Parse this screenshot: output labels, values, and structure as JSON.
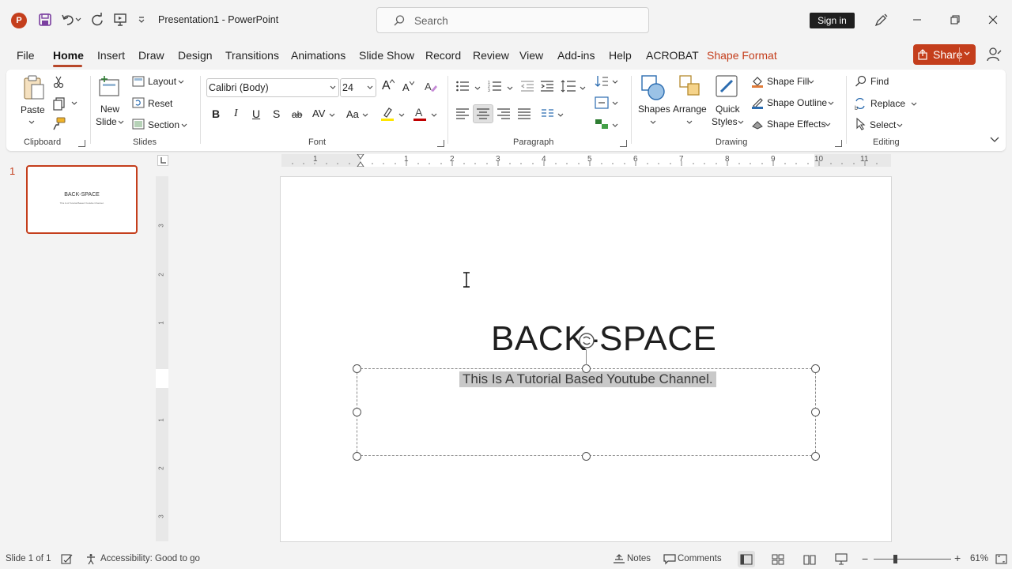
{
  "window": {
    "document_title": "Presentation1",
    "app_name": "PowerPoint",
    "title_separator": " - ",
    "search_placeholder": "Search",
    "sign_in": "Sign in"
  },
  "tabs": [
    {
      "label": "File"
    },
    {
      "label": "Home",
      "active": true
    },
    {
      "label": "Insert"
    },
    {
      "label": "Draw"
    },
    {
      "label": "Design"
    },
    {
      "label": "Transitions"
    },
    {
      "label": "Animations"
    },
    {
      "label": "Slide Show"
    },
    {
      "label": "Record"
    },
    {
      "label": "Review"
    },
    {
      "label": "View"
    },
    {
      "label": "Add-ins"
    },
    {
      "label": "Help"
    },
    {
      "label": "ACROBAT"
    },
    {
      "label": "Shape Format"
    }
  ],
  "share": {
    "label": "Share"
  },
  "ribbon": {
    "clipboard": {
      "paste": "Paste",
      "group": "Clipboard"
    },
    "slides": {
      "new_slide_line1": "New",
      "new_slide_line2": "Slide",
      "layout": "Layout",
      "reset": "Reset",
      "section": "Section",
      "group": "Slides"
    },
    "font": {
      "font_name": "Calibri (Body)",
      "font_size": "24",
      "bold": "B",
      "italic": "I",
      "underline": "U",
      "strike": "S",
      "strike2": "ab",
      "spacing": "AV",
      "case": "Aa",
      "grow": "A",
      "shrink": "A",
      "group": "Font"
    },
    "paragraph": {
      "group": "Paragraph"
    },
    "drawing": {
      "shapes": "Shapes",
      "arrange": "Arrange",
      "quick_styles_line1": "Quick",
      "quick_styles_line2": "Styles",
      "shape_fill": "Shape Fill",
      "shape_outline": "Shape Outline",
      "shape_effects": "Shape Effects",
      "group": "Drawing"
    },
    "editing": {
      "find": "Find",
      "replace": "Replace",
      "select": "Select",
      "group": "Editing"
    }
  },
  "thumbnails": [
    {
      "number": "1",
      "title": "BACK-SPACE",
      "subtitle": "This Is A Tutorial Based Youtube Channel."
    }
  ],
  "ruler": {
    "horizontal": [
      "1",
      "1",
      "2",
      "3",
      "4",
      "5",
      "6",
      "7",
      "8",
      "9",
      "10",
      "11"
    ],
    "vertical": [
      "3",
      "2",
      "1",
      "1",
      "2",
      "3"
    ]
  },
  "slide": {
    "title": "BACK-SPACE",
    "subtitle": "This Is A Tutorial Based Youtube Channel."
  },
  "status": {
    "slide_info": "Slide 1 of 1",
    "accessibility": "Accessibility: Good to go",
    "notes": "Notes",
    "comments": "Comments",
    "zoom_minus": "−",
    "zoom_plus": "+",
    "zoom": "61%"
  },
  "colors": {
    "accent": "#c43e1c",
    "font_color": "#c00000",
    "highlight": "#ffe600"
  }
}
